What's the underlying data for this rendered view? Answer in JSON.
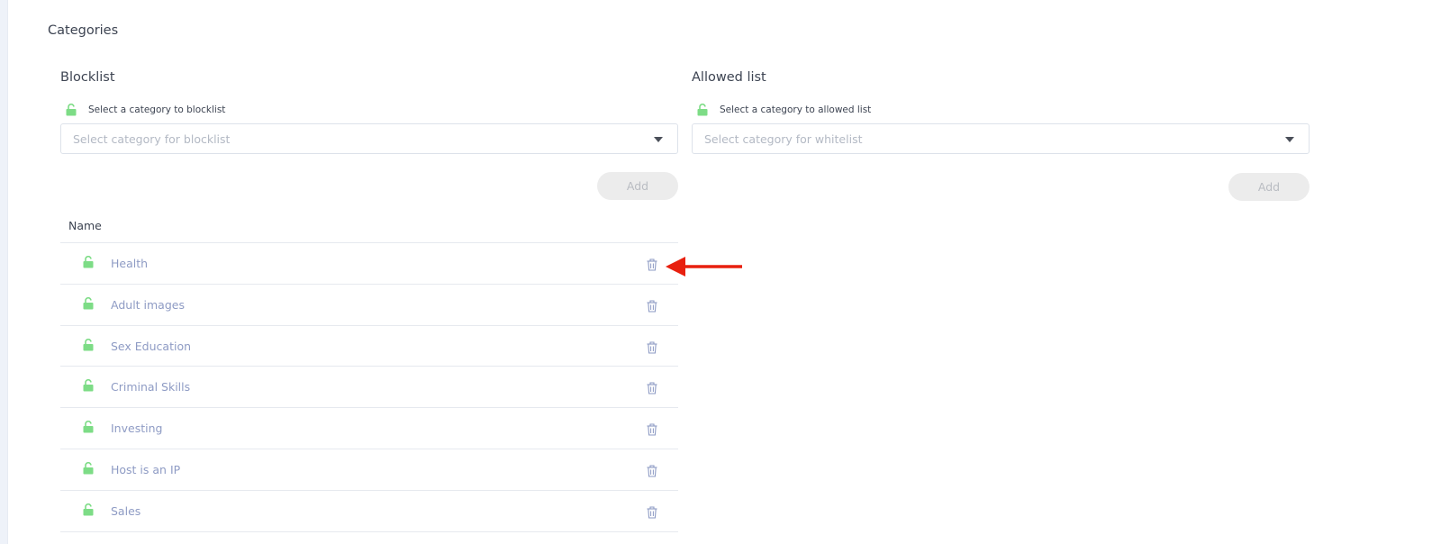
{
  "page": {
    "title": "Categories"
  },
  "blocklist": {
    "title": "Blocklist",
    "select_label": "Select a category to blocklist",
    "placeholder": "Select category for blocklist",
    "add_label": "Add"
  },
  "allowed": {
    "title": "Allowed list",
    "select_label": "Select a category to allowed list",
    "placeholder": "Select category for whitelist",
    "add_label": "Add"
  },
  "table": {
    "header_name": "Name",
    "rows": [
      {
        "name": "Health"
      },
      {
        "name": "Adult images"
      },
      {
        "name": "Sex Education"
      },
      {
        "name": "Criminal Skills"
      },
      {
        "name": "Investing"
      },
      {
        "name": "Host is an IP"
      },
      {
        "name": "Sales"
      }
    ]
  },
  "icons": {
    "lock": "unlock-icon",
    "trash": "trash-icon",
    "caret": "chevron-down-icon",
    "annotation": "red-arrow-icon"
  },
  "colors": {
    "lock_green": "#7ddc86",
    "row_text": "#8e9bc4",
    "trash": "#8e9bc4",
    "arrow_red": "#e8200f",
    "button_bg": "#ececec"
  }
}
